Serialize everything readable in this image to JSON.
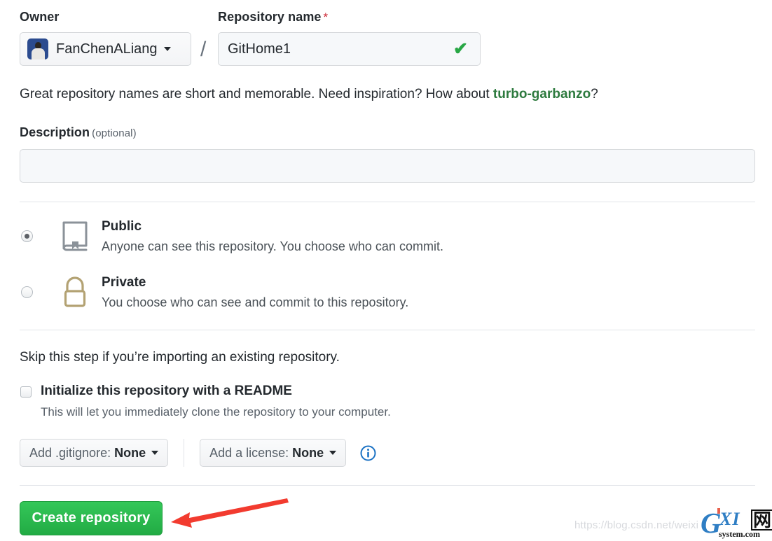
{
  "owner": {
    "label": "Owner",
    "name": "FanChenALiang"
  },
  "separator": "/",
  "repository": {
    "label": "Repository name",
    "required_mark": "*",
    "value": "GitHome1",
    "valid_mark": "✔"
  },
  "hint": {
    "before": "Great repository names are short and memorable. Need inspiration? How about ",
    "suggestion": "turbo-garbanzo",
    "after": "?"
  },
  "description": {
    "label": "Description",
    "optional": "(optional)",
    "value": "",
    "placeholder": ""
  },
  "visibility": {
    "options": [
      {
        "title": "Public",
        "subtitle": "Anyone can see this repository. You choose who can commit.",
        "icon": "repo-book-icon",
        "selected": true
      },
      {
        "title": "Private",
        "subtitle": "You choose who can see and commit to this repository.",
        "icon": "lock-icon",
        "selected": false
      }
    ]
  },
  "import": {
    "skip_text": "Skip this step if you’re importing an existing repository.",
    "readme_label": "Initialize this repository with a README",
    "readme_sub": "This will let you immediately clone the repository to your computer.",
    "readme_checked": false
  },
  "dropdowns": {
    "gitignore": {
      "prefix": "Add .gitignore:",
      "value": "None"
    },
    "license": {
      "prefix": "Add a license:",
      "value": "None"
    },
    "info_icon": "info-circle-icon"
  },
  "submit": {
    "label": "Create repository"
  },
  "annotation": {
    "arrow": "red-arrow-pointing-left"
  },
  "watermark": {
    "url": "https://blog.csdn.net/weixi",
    "logo_g": "G",
    "logo_xi": "XI",
    "logo_cjk": "网",
    "logo_sub": "system.com"
  },
  "colors": {
    "accent_green": "#22ab44",
    "link_green": "#2d7a3e",
    "required_red": "#cb2431",
    "info_blue": "#2f7ec4",
    "lock_tan": "#b3a273",
    "repo_gray": "#8b9299",
    "arrow_red": "#f23b2f"
  }
}
